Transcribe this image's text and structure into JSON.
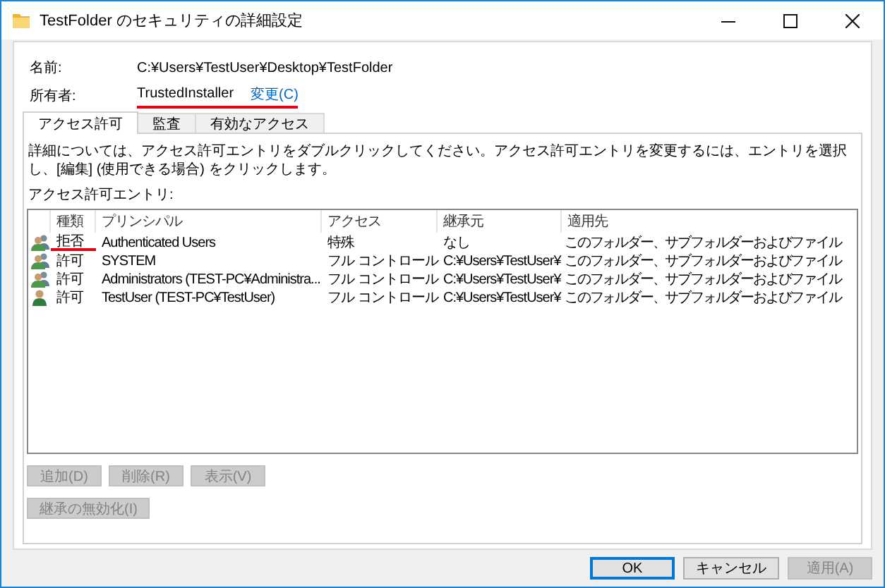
{
  "window": {
    "title": "TestFolder のセキュリティの詳細設定"
  },
  "name_field": {
    "label": "名前:",
    "value": "C:¥Users¥TestUser¥Desktop¥TestFolder"
  },
  "owner": {
    "label": "所有者:",
    "value": "TrustedInstaller",
    "link": "変更(C)",
    "underlined": true
  },
  "tabs": [
    {
      "label": "アクセス許可",
      "selected": true
    },
    {
      "label": "監査",
      "selected": false
    },
    {
      "label": "有効なアクセス",
      "selected": false
    }
  ],
  "description": "詳細については、アクセス許可エントリをダブルクリックしてください。アクセス許可エントリを変更するには、エントリを選択し、[編集] (使用できる場合) をクリックします。",
  "list_label": "アクセス許可エントリ:",
  "table": {
    "columns": [
      "種類",
      "プリンシパル",
      "アクセス",
      "継承元",
      "適用先"
    ],
    "rows": [
      {
        "kind": "group",
        "type": "拒否",
        "underlined": true,
        "principal": "Authenticated Users",
        "access": "特殊",
        "inherited_from": "なし",
        "applies_to": "このフォルダー、サブフォルダーおよびファイル"
      },
      {
        "kind": "group",
        "type": "許可",
        "underlined": false,
        "principal": "SYSTEM",
        "access": "フル コントロール",
        "inherited_from": "C:¥Users¥TestUser¥",
        "applies_to": "このフォルダー、サブフォルダーおよびファイル"
      },
      {
        "kind": "group",
        "type": "許可",
        "underlined": false,
        "principal": "Administrators (TEST-PC¥Administra...",
        "access": "フル コントロール",
        "inherited_from": "C:¥Users¥TestUser¥",
        "applies_to": "このフォルダー、サブフォルダーおよびファイル"
      },
      {
        "kind": "user",
        "type": "許可",
        "underlined": false,
        "principal": "TestUser (TEST-PC¥TestUser)",
        "access": "フル コントロール",
        "inherited_from": "C:¥Users¥TestUser¥",
        "applies_to": "このフォルダー、サブフォルダーおよびファイル"
      }
    ]
  },
  "entry_buttons": [
    {
      "label": "追加(D)",
      "disabled": true
    },
    {
      "label": "削除(R)",
      "disabled": true
    },
    {
      "label": "表示(V)",
      "disabled": true
    }
  ],
  "inheritance_button": {
    "label": "継承の無効化(I)",
    "disabled": true
  },
  "dialog_buttons": [
    {
      "label": "OK",
      "default": true,
      "disabled": false
    },
    {
      "label": "キャンセル",
      "default": false,
      "disabled": false
    },
    {
      "label": "適用(A)",
      "default": false,
      "disabled": true
    }
  ]
}
